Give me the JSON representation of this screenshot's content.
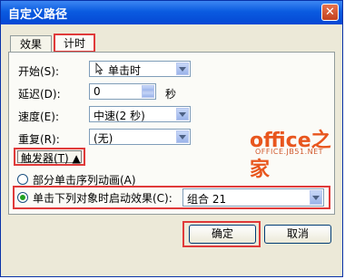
{
  "dialog": {
    "title": "自定义路径",
    "close_symbol": "✕"
  },
  "tabs": [
    {
      "label": "效果"
    },
    {
      "label": "计时"
    }
  ],
  "fields": {
    "start_label": "开始(S):",
    "start_value": "单击时",
    "delay_label": "延迟(D):",
    "delay_value": "0",
    "delay_unit": "秒",
    "speed_label": "速度(E):",
    "speed_value": "中速(2 秒)",
    "repeat_label": "重复(R):",
    "repeat_value": "(无)"
  },
  "trigger": {
    "label": "触发器(T) ▲",
    "option1": "部分单击序列动画(A)",
    "option2": "单击下列对象时启动效果(C):",
    "object_value": "组合 21"
  },
  "watermark": {
    "brand": "office之家",
    "url": "OFFICE.JB51.NET"
  },
  "buttons": {
    "ok": "确定",
    "cancel": "取消"
  }
}
